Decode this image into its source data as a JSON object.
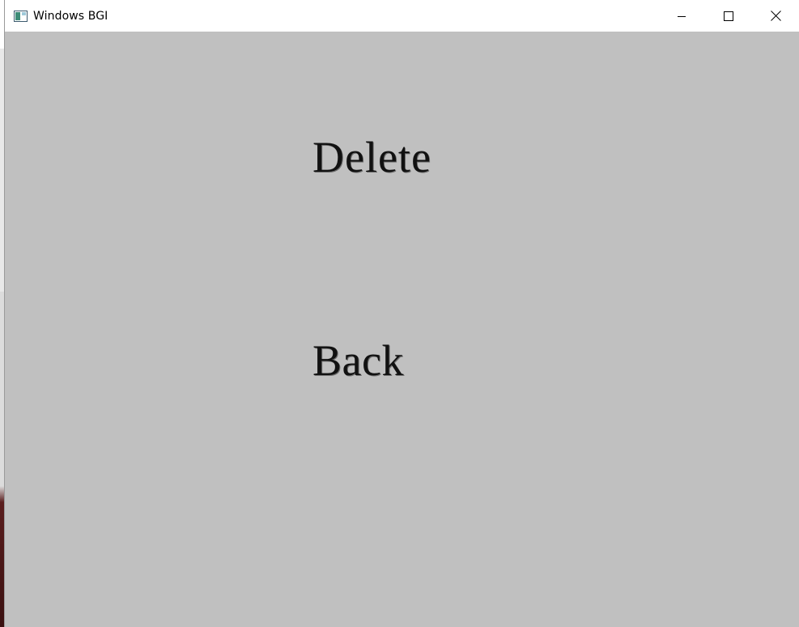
{
  "window": {
    "title": "Windows BGI",
    "icon": "bgi-app-icon",
    "controls": {
      "minimize": "minimize-icon",
      "maximize": "maximize-icon",
      "close": "close-icon"
    },
    "background_color": "#c0c0c0"
  },
  "menu": {
    "options": [
      {
        "label": "Delete"
      },
      {
        "label": "Back"
      }
    ]
  }
}
